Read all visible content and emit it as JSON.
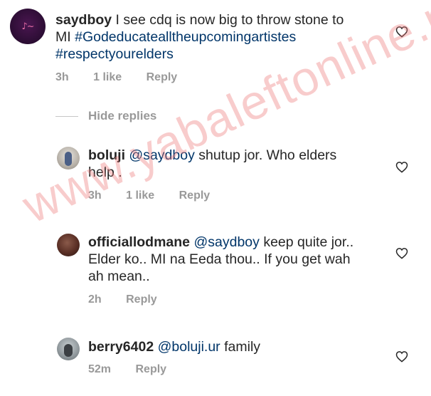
{
  "watermark": "www.yabaleftonline.ng",
  "main_comment": {
    "username": "saydboy",
    "text_line1": "I see cdq is now big to throw stone to",
    "text_line2_plain": "MI",
    "hashtag1": "#Godeducatealltheupcomingartistes",
    "hashtag2": "#respectyourelders",
    "time": "3h",
    "likes": "1 like",
    "reply": "Reply"
  },
  "hide_replies": "Hide replies",
  "replies": [
    {
      "username": "boluji",
      "mention": "@saydboy",
      "text1": "shutup jor. Who elders",
      "text2": "help .",
      "time": "3h",
      "likes": "1 like",
      "reply": "Reply"
    },
    {
      "username": "officiallodmane",
      "mention": "@saydboy",
      "text1": "keep quite jor..",
      "text2": "Elder ko.. MI na Eeda thou.. If you get wah",
      "text3": "ah mean..",
      "time": "2h",
      "reply": "Reply"
    },
    {
      "username": "berry6402",
      "mention": "@boluji.ur",
      "text1": "family",
      "time": "52m",
      "reply": "Reply"
    }
  ],
  "icons": {
    "like": "heart-outline-icon"
  },
  "colors": {
    "link": "#003569",
    "meta": "#999999",
    "text": "#262626"
  }
}
